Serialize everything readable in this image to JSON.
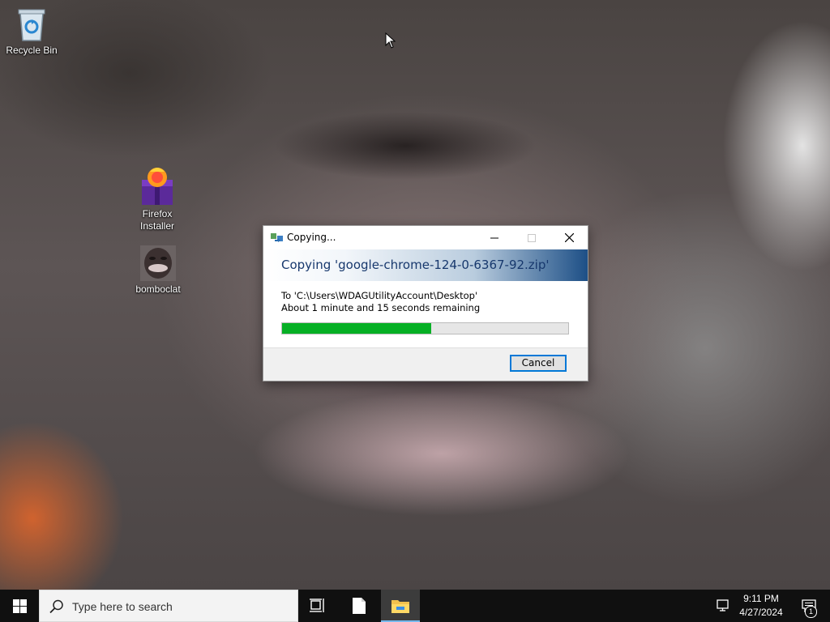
{
  "desktop": {
    "icons": [
      {
        "label": "Recycle Bin",
        "icon": "recycle-bin-icon"
      },
      {
        "label": "Firefox Installer",
        "icon": "firefox-installer-icon"
      },
      {
        "label": "bomboclat",
        "icon": "image-thumbnail-icon"
      }
    ]
  },
  "dialog": {
    "title": "Copying...",
    "heading": "Copying 'google-chrome-124-0-6367-92.zip'",
    "destination": "To 'C:\\Users\\WDAGUtilityAccount\\Desktop'",
    "time_remaining": "About 1 minute and 15 seconds remaining",
    "progress_fraction": 0.52,
    "cancel_label": "Cancel",
    "progress_color": "#06b025"
  },
  "taskbar": {
    "search_placeholder": "Type here to search",
    "clock_time": "9:11 PM",
    "clock_date": "4/27/2024",
    "notification_count": "1"
  }
}
